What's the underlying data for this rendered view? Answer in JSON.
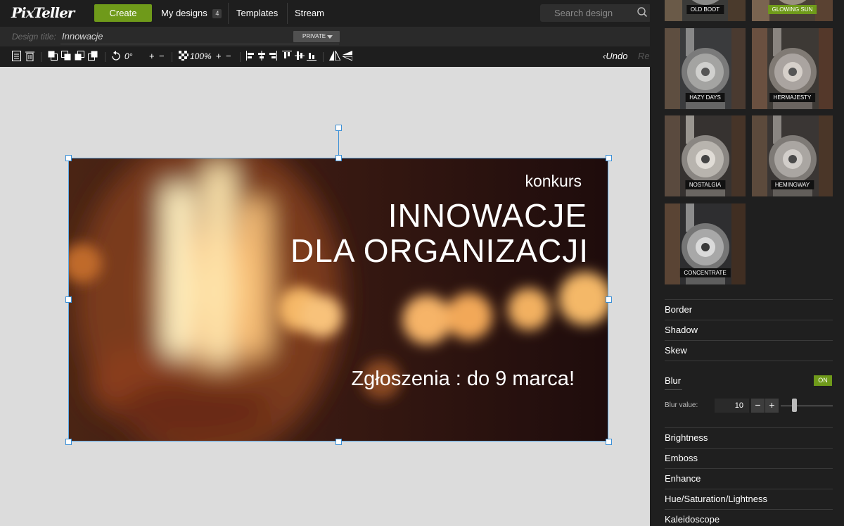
{
  "topbar": {
    "logo": "PixTeller",
    "create_label": "Create",
    "my_designs_label": "My designs",
    "my_designs_count": "4",
    "templates_label": "Templates",
    "stream_label": "Stream",
    "search_placeholder": "Search design"
  },
  "titlebar": {
    "label": "Design title:",
    "value": "Innowacje",
    "privacy": "PRIVATE"
  },
  "toolbar": {
    "rotation": "0°",
    "zoom": "100%",
    "plus": "+",
    "minus": "−",
    "undo": "Undo",
    "redo": "Re"
  },
  "design": {
    "subtitle": "konkurs",
    "title_line1": "INNOWACJE",
    "title_line2": "DLA ORGANIZACJI",
    "deadline": "Zgłoszenia : do 9 marca!"
  },
  "filters": {
    "items": [
      {
        "label": "OLD BOOT",
        "active": false
      },
      {
        "label": "GLOWING SUN",
        "active": true
      },
      {
        "label": "HAZY DAYS",
        "active": false
      },
      {
        "label": "HERMAJESTY",
        "active": false
      },
      {
        "label": "NOSTALGIA",
        "active": false
      },
      {
        "label": "HEMINGWAY",
        "active": false
      },
      {
        "label": "CONCENTRATE",
        "active": false
      }
    ]
  },
  "effects": {
    "border": "Border",
    "shadow": "Shadow",
    "skew": "Skew",
    "blur": "Blur",
    "blur_toggle": "ON",
    "blur_value_label": "Blur value:",
    "blur_value": "10",
    "minus": "−",
    "plus": "+",
    "brightness": "Brightness",
    "emboss": "Emboss",
    "enhance": "Enhance",
    "hsl": "Hue/Saturation/Lightness",
    "kaleidoscope": "Kaleidoscope"
  },
  "colors": {
    "accent": "#6f9a1a",
    "selection": "#3a8fd6",
    "dark": "#1e1e1e"
  }
}
